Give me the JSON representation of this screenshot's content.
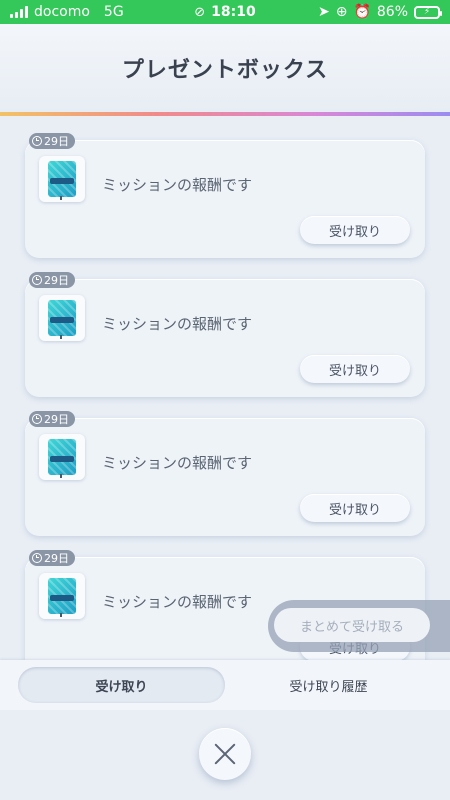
{
  "status_bar": {
    "carrier": "docomo",
    "network": "5G",
    "time": "18:10",
    "battery": "86%",
    "icons": [
      "signal-icon",
      "link-icon",
      "location-icon",
      "orientation-lock-icon",
      "alarm-icon",
      "battery-icon"
    ]
  },
  "header": {
    "title": "プレゼントボックス"
  },
  "items": [
    {
      "days_left": "29日",
      "message": "ミッションの報酬です",
      "receive_label": "受け取り",
      "icon": "item-ticket-icon"
    },
    {
      "days_left": "29日",
      "message": "ミッションの報酬です",
      "receive_label": "受け取り",
      "icon": "item-ticket-icon"
    },
    {
      "days_left": "29日",
      "message": "ミッションの報酬です",
      "receive_label": "受け取り",
      "icon": "item-ticket-icon"
    },
    {
      "days_left": "29日",
      "message": "ミッションの報酬です",
      "receive_label": "受け取り",
      "icon": "item-ticket-icon"
    }
  ],
  "bulk_receive_label": "まとめて受け取る",
  "tabs": [
    {
      "label": "受け取り",
      "active": true
    },
    {
      "label": "受け取り履歴",
      "active": false
    }
  ],
  "colors": {
    "status_bar": "#34c759",
    "background": "#e9eef5",
    "badge": "#8a95a6",
    "item_tile": "#3fd6d6"
  }
}
